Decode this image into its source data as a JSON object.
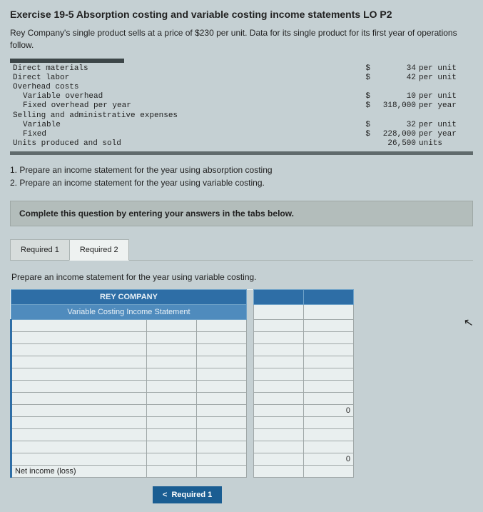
{
  "title": "Exercise 19-5 Absorption costing and variable costing income statements LO P2",
  "intro": "Rey Company's single product sells at a price of $230 per unit. Data for its single product for its first year of operations follow.",
  "rows": {
    "dm_label": "Direct materials",
    "dm_amt": "34",
    "dm_unit": "per unit",
    "dl_label": "Direct labor",
    "dl_amt": "42",
    "dl_unit": "per unit",
    "oh_label": "Overhead costs",
    "voh_label": "Variable overhead",
    "voh_amt": "10",
    "voh_unit": "per unit",
    "foh_label": "Fixed overhead per year",
    "foh_amt": "318,000",
    "foh_unit": "per year",
    "sa_label": "Selling and administrative expenses",
    "vsa_label": "Variable",
    "vsa_amt": "32",
    "vsa_unit": "per unit",
    "fsa_label": "Fixed",
    "fsa_amt": "228,000",
    "fsa_unit": "per year",
    "units_label": "Units produced and sold",
    "units_amt": "26,500",
    "units_unit": "units"
  },
  "req1": "1. Prepare an income statement for the year using absorption costing",
  "req2": "2. Prepare an income statement for the year using variable costing.",
  "hint": "Complete this question by entering your answers in the tabs below.",
  "tabs": {
    "t1": "Required 1",
    "t2": "Required 2"
  },
  "panel_desc": "Prepare an income statement for the year using variable costing.",
  "ws": {
    "company": "REY COMPANY",
    "statement": "Variable Costing Income Statement",
    "zero": "0",
    "net": "Net income (loss)"
  },
  "nav": {
    "prev": "Required 1",
    "chev": "<"
  }
}
